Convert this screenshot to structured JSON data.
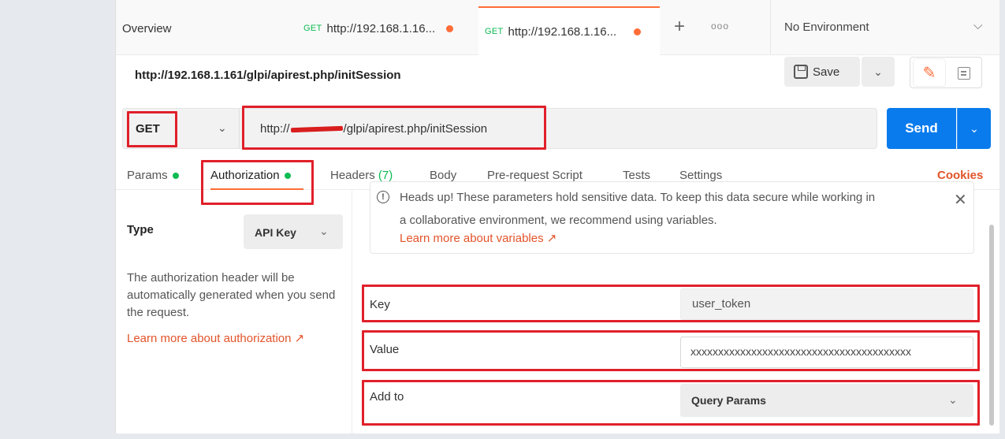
{
  "tabs": {
    "overview": "Overview",
    "req1": {
      "method": "GET",
      "url": "http://192.168.1.16..."
    },
    "req2": {
      "method": "GET",
      "url": "http://192.168.1.16..."
    },
    "plus": "+",
    "more": "ooo",
    "environment": "No Environment"
  },
  "request": {
    "title": "http://192.168.1.161/glpi/apirest.php/initSession",
    "save_label": "Save",
    "method": "GET",
    "url_prefix": "http://",
    "url_suffix": "/glpi/apirest.php/initSession",
    "send_label": "Send"
  },
  "request_tabs": {
    "params": "Params",
    "authorization": "Authorization",
    "headers": "Headers",
    "headers_count": "(7)",
    "body": "Body",
    "prerequest": "Pre-request Script",
    "tests": "Tests",
    "settings": "Settings",
    "cookies": "Cookies"
  },
  "auth": {
    "type_label": "Type",
    "type_value": "API Key",
    "description": "The authorization header will be automatically generated when you send the request.",
    "learn_link": "Learn more about authorization ↗",
    "notice_line1": "Heads up! These parameters hold sensitive data. To keep this data secure while working in",
    "notice_line2": "a collaborative environment, we recommend using variables.",
    "notice_link": "Learn more about variables ↗",
    "key_label": "Key",
    "key_value": "user_token",
    "value_label": "Value",
    "value_value": "xxxxxxxxxxxxxxxxxxxxxxxxxxxxxxxxxxxxxxxx",
    "addto_label": "Add to",
    "addto_value": "Query Params"
  },
  "colors": {
    "accent": "#ff6c37",
    "send": "#097bed",
    "get_method": "#0cbb52",
    "link": "#e2542a",
    "annotation": "#e0202a"
  }
}
